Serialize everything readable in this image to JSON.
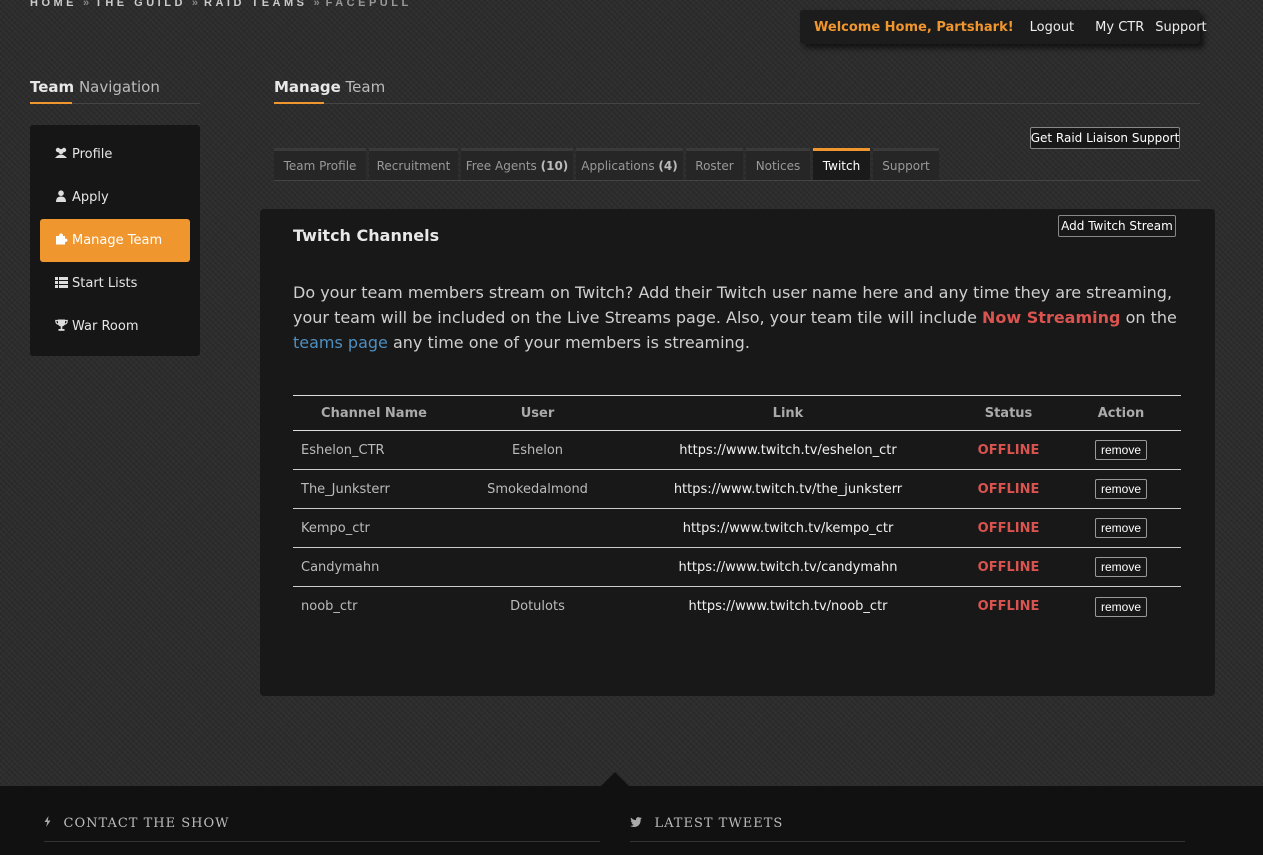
{
  "breadcrumb": {
    "items": [
      "HOME",
      "THE GUILD",
      "RAID TEAMS"
    ],
    "separator": "»",
    "current": "FACEPULL"
  },
  "topbar": {
    "welcome": "Welcome Home, Partshark!",
    "logout": "Logout",
    "my_ctr": "My CTR",
    "support": "Support"
  },
  "sidebar": {
    "title_bold": "Team",
    "title_rest": " Navigation",
    "items": [
      {
        "label": "Profile",
        "icon": "users-icon"
      },
      {
        "label": "Apply",
        "icon": "user-icon"
      },
      {
        "label": "Manage Team",
        "icon": "puzzle-icon",
        "active": true
      },
      {
        "label": "Start Lists",
        "icon": "list-icon"
      },
      {
        "label": "War Room",
        "icon": "trophy-icon"
      }
    ]
  },
  "main": {
    "title_bold": "Manage",
    "title_rest": " Team",
    "liaison_button": "Get Raid Liaison Support",
    "tabs": [
      {
        "label": "Team Profile",
        "count": ""
      },
      {
        "label": "Recruitment",
        "count": ""
      },
      {
        "label": "Free Agents",
        "count": "(10)"
      },
      {
        "label": "Applications",
        "count": "(4)"
      },
      {
        "label": "Roster",
        "count": ""
      },
      {
        "label": "Notices",
        "count": ""
      },
      {
        "label": "Twitch",
        "count": "",
        "active": true
      },
      {
        "label": "Support",
        "count": ""
      }
    ]
  },
  "panel": {
    "title": "Twitch Channels",
    "add_button": "Add Twitch Stream",
    "desc_part1": "Do your team members stream on Twitch? Add their Twitch user name here and any time they are streaming, your team will be included on the Live Streams page. Also, your team tile will include ",
    "desc_streaming": "Now Streaming",
    "desc_part2": " on the ",
    "desc_link": "teams page",
    "desc_part3": " any time one of your members is streaming.",
    "columns": [
      "Channel Name",
      "User",
      "Link",
      "Status",
      "Action"
    ],
    "rows": [
      {
        "channel": "Eshelon_CTR",
        "user": "Eshelon",
        "link": "https://www.twitch.tv/eshelon_ctr",
        "status": "OFFLINE",
        "action": "remove"
      },
      {
        "channel": "The_Junksterr",
        "user": "Smokedalmond",
        "link": "https://www.twitch.tv/the_junksterr",
        "status": "OFFLINE",
        "action": "remove"
      },
      {
        "channel": "Kempo_ctr",
        "user": "",
        "link": "https://www.twitch.tv/kempo_ctr",
        "status": "OFFLINE",
        "action": "remove"
      },
      {
        "channel": "Candymahn",
        "user": "",
        "link": "https://www.twitch.tv/candymahn",
        "status": "OFFLINE",
        "action": "remove"
      },
      {
        "channel": "noob_ctr",
        "user": "Dotulots",
        "link": "https://www.twitch.tv/noob_ctr",
        "status": "OFFLINE",
        "action": "remove"
      }
    ]
  },
  "footer": {
    "contact": "CONTACT THE SHOW",
    "contact_icon": "bolt-icon",
    "tweets": "LATEST TWEETS",
    "tweets_icon": "twitter-icon"
  },
  "colors": {
    "accent": "#f0962e",
    "status_offline": "#d9534f",
    "link": "#4f8fc0"
  }
}
